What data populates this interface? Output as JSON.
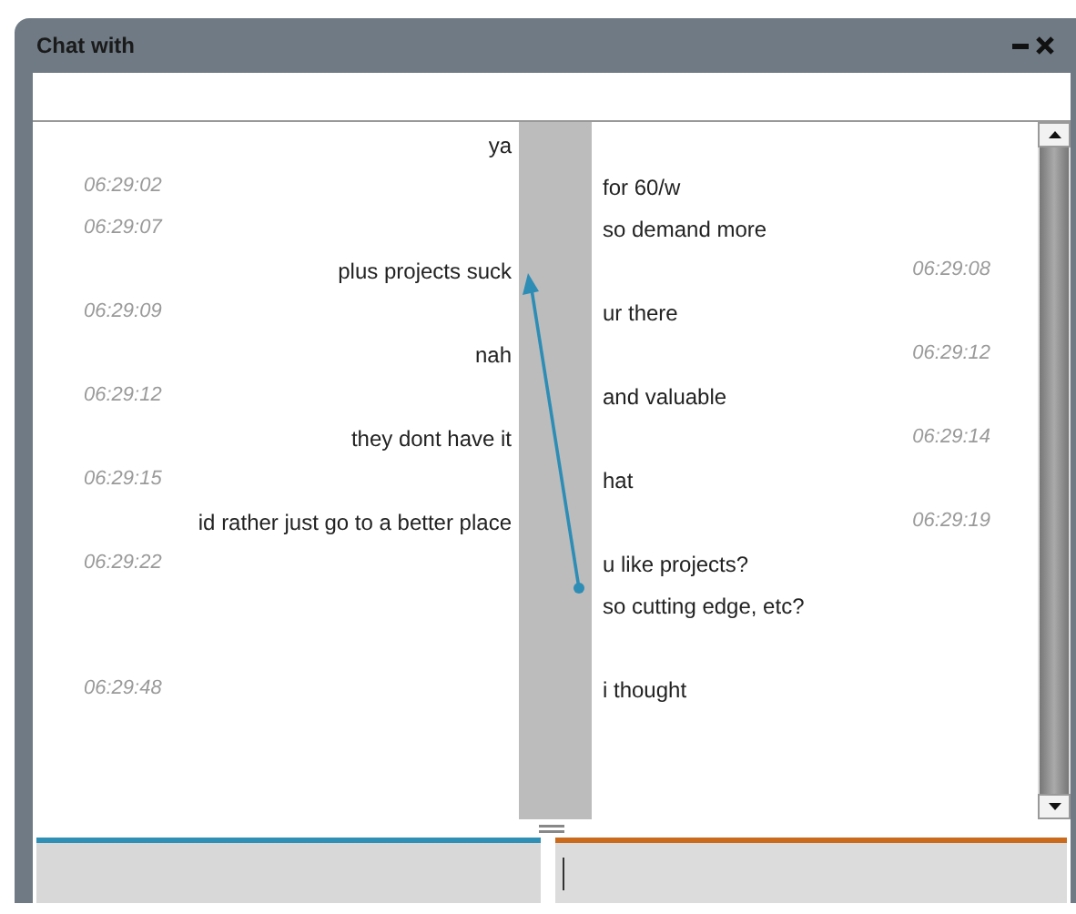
{
  "window": {
    "title": "Chat with"
  },
  "rows": [
    {
      "left": {
        "kind": "message",
        "text": "ya"
      }
    },
    {
      "left": {
        "kind": "time",
        "text": "06:29:02"
      },
      "right": {
        "kind": "message",
        "text": "for 60/w"
      }
    },
    {
      "left": {
        "kind": "time",
        "text": "06:29:07"
      },
      "right": {
        "kind": "message",
        "text": "so demand more"
      }
    },
    {
      "left": {
        "kind": "message",
        "text": "plus projects suck"
      },
      "right": {
        "kind": "time",
        "text": "06:29:08"
      }
    },
    {
      "left": {
        "kind": "time",
        "text": "06:29:09"
      },
      "right": {
        "kind": "message",
        "text": "ur there"
      }
    },
    {
      "left": {
        "kind": "message",
        "text": "nah"
      },
      "right": {
        "kind": "time",
        "text": "06:29:12"
      }
    },
    {
      "left": {
        "kind": "time",
        "text": "06:29:12"
      },
      "right": {
        "kind": "message",
        "text": "and valuable"
      }
    },
    {
      "left": {
        "kind": "message",
        "text": "they dont have it"
      },
      "right": {
        "kind": "time",
        "text": "06:29:14"
      }
    },
    {
      "left": {
        "kind": "time",
        "text": "06:29:15"
      },
      "right": {
        "kind": "message",
        "text": "hat"
      }
    },
    {
      "left": {
        "kind": "message",
        "text": "id rather just go to a better place"
      },
      "right": {
        "kind": "time",
        "text": "06:29:19"
      }
    },
    {
      "left": {
        "kind": "time",
        "text": "06:29:22"
      },
      "right": {
        "kind": "message",
        "text": "u like projects?"
      }
    },
    {
      "right": {
        "kind": "message",
        "text": "so cutting edge, etc?"
      }
    },
    {},
    {
      "left": {
        "kind": "time",
        "text": "06:29:48"
      },
      "right": {
        "kind": "message",
        "text": "i thought"
      }
    }
  ]
}
